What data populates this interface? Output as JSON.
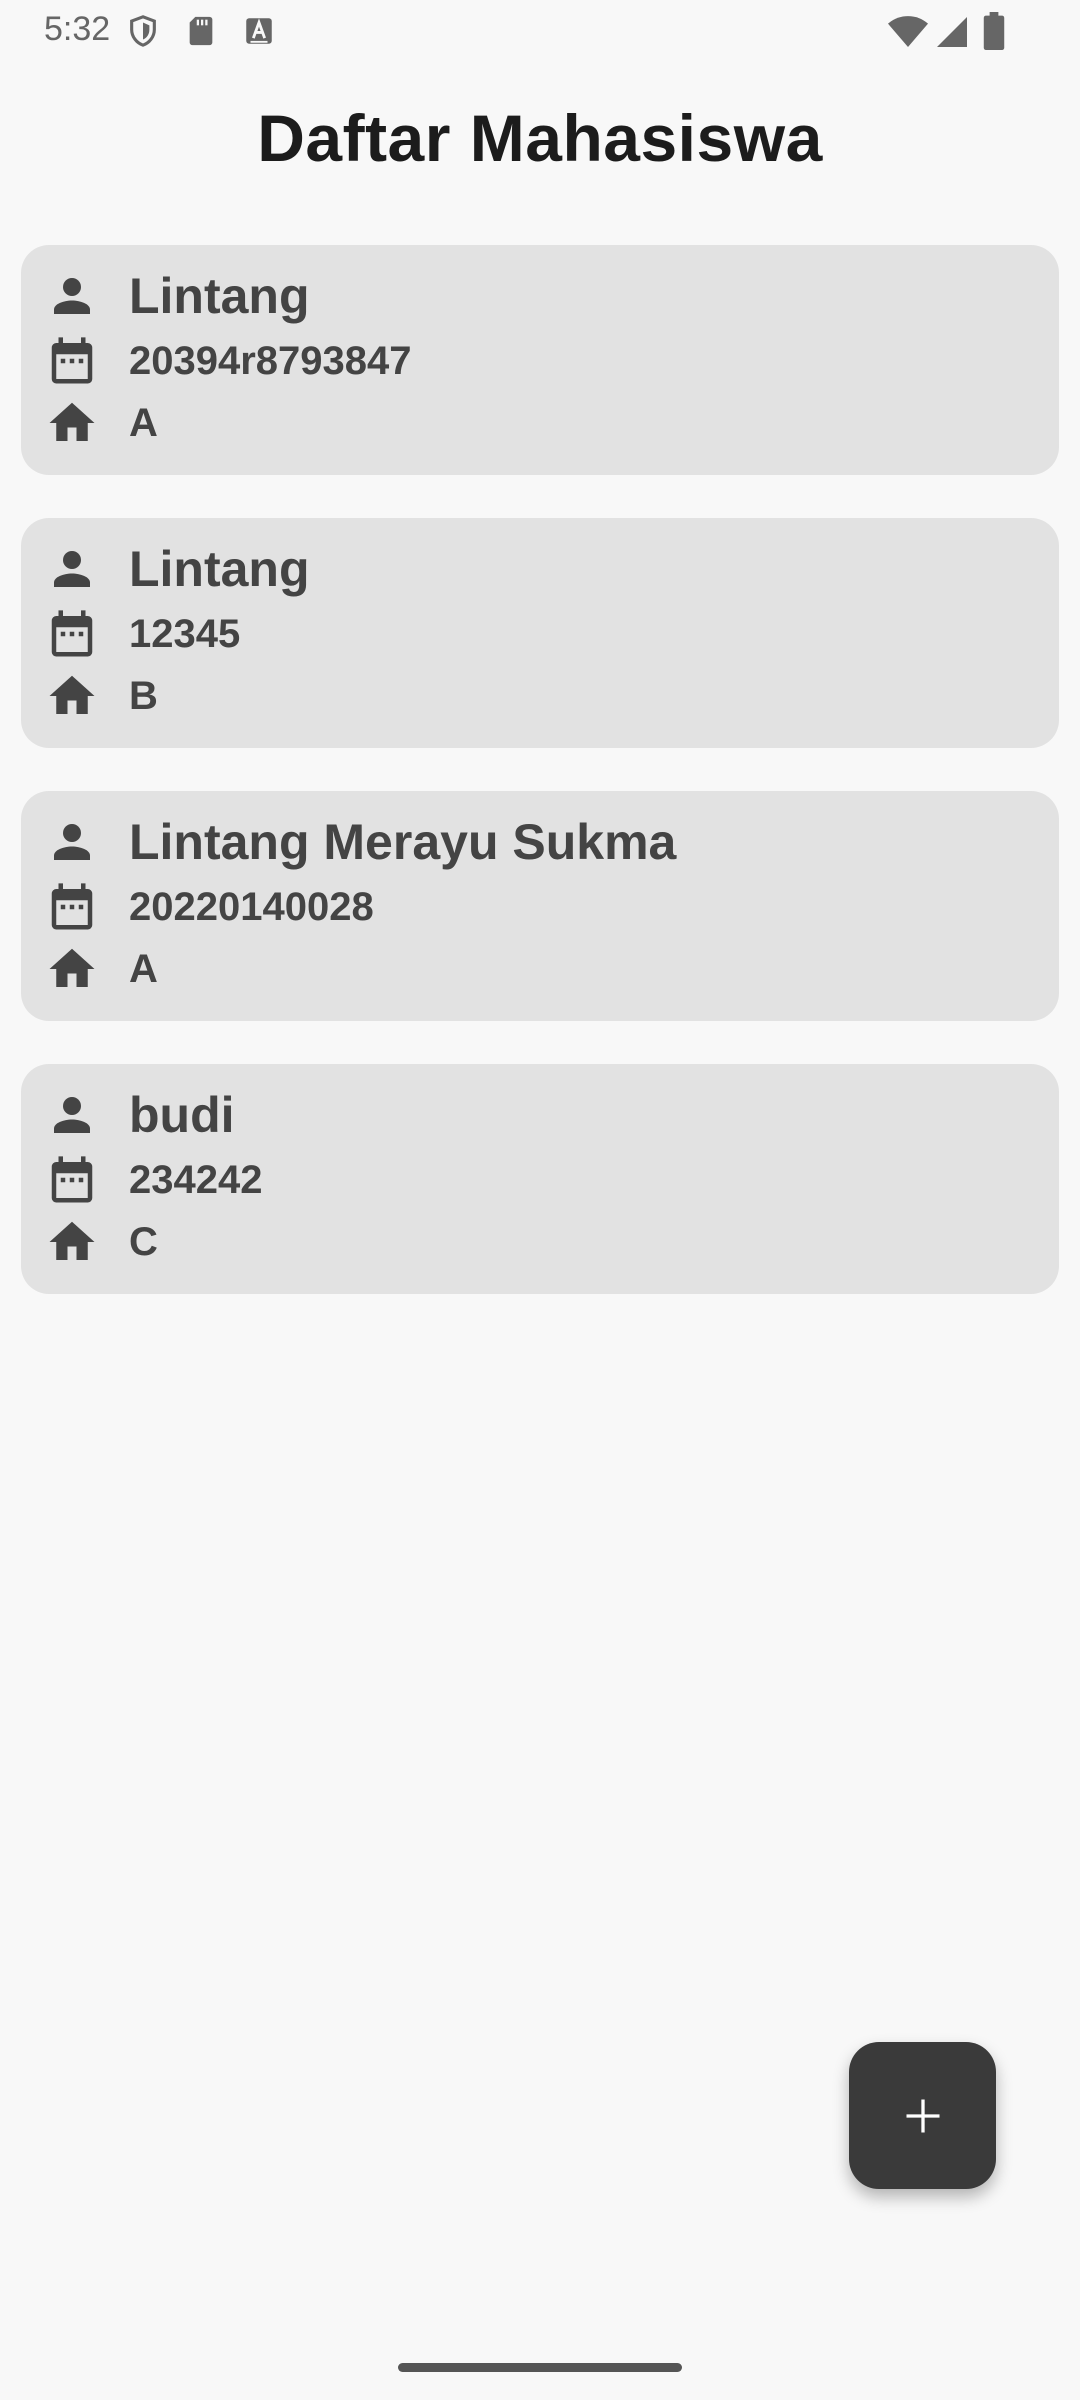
{
  "status_bar": {
    "time": "5:32",
    "left_icons": [
      "shield-icon",
      "sd-card-icon",
      "a-box-icon"
    ],
    "right_icons": [
      "wifi-icon",
      "signal-icon",
      "battery-icon"
    ]
  },
  "title": "Daftar Mahasiswa",
  "students": [
    {
      "name": "Lintang",
      "nim": "20394r8793847",
      "kelas": "A"
    },
    {
      "name": "Lintang",
      "nim": "12345",
      "kelas": "B"
    },
    {
      "name": "Lintang Merayu Sukma",
      "nim": "20220140028",
      "kelas": "A"
    },
    {
      "name": "budi",
      "nim": "234242",
      "kelas": "C"
    }
  ],
  "fab": {
    "icon": "plus-icon"
  },
  "colors": {
    "background": "#f8f8f8",
    "card": "#e2e2e2",
    "text": "#444444",
    "title": "#1c1c1c",
    "fab": "#3a3a3a"
  }
}
